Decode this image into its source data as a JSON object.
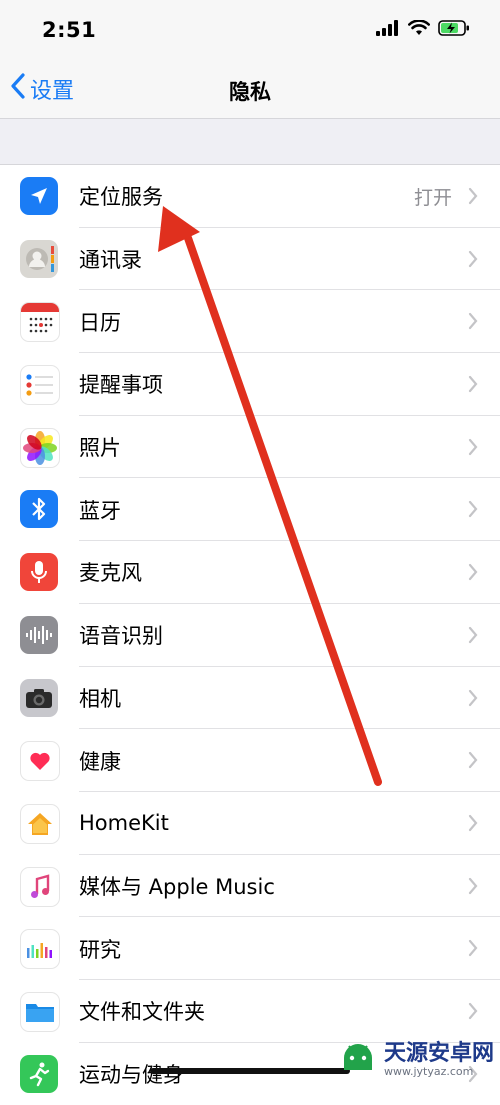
{
  "status_bar": {
    "time": "2:51"
  },
  "nav": {
    "back_label": "设置",
    "title": "隐私"
  },
  "rows": [
    {
      "label": "定位服务",
      "value": "打开"
    },
    {
      "label": "通讯录"
    },
    {
      "label": "日历"
    },
    {
      "label": "提醒事项"
    },
    {
      "label": "照片"
    },
    {
      "label": "蓝牙"
    },
    {
      "label": "麦克风"
    },
    {
      "label": "语音识别"
    },
    {
      "label": "相机"
    },
    {
      "label": "健康"
    },
    {
      "label": "HomeKit"
    },
    {
      "label": "媒体与 Apple Music"
    },
    {
      "label": "研究"
    },
    {
      "label": "文件和文件夹"
    },
    {
      "label": "运动与健身"
    }
  ],
  "watermark": {
    "name": "天源安卓网",
    "url": "www.jytyaz.com"
  },
  "colors": {
    "accent": "#1a7cf5",
    "annotation_arrow": "#e0301e"
  }
}
